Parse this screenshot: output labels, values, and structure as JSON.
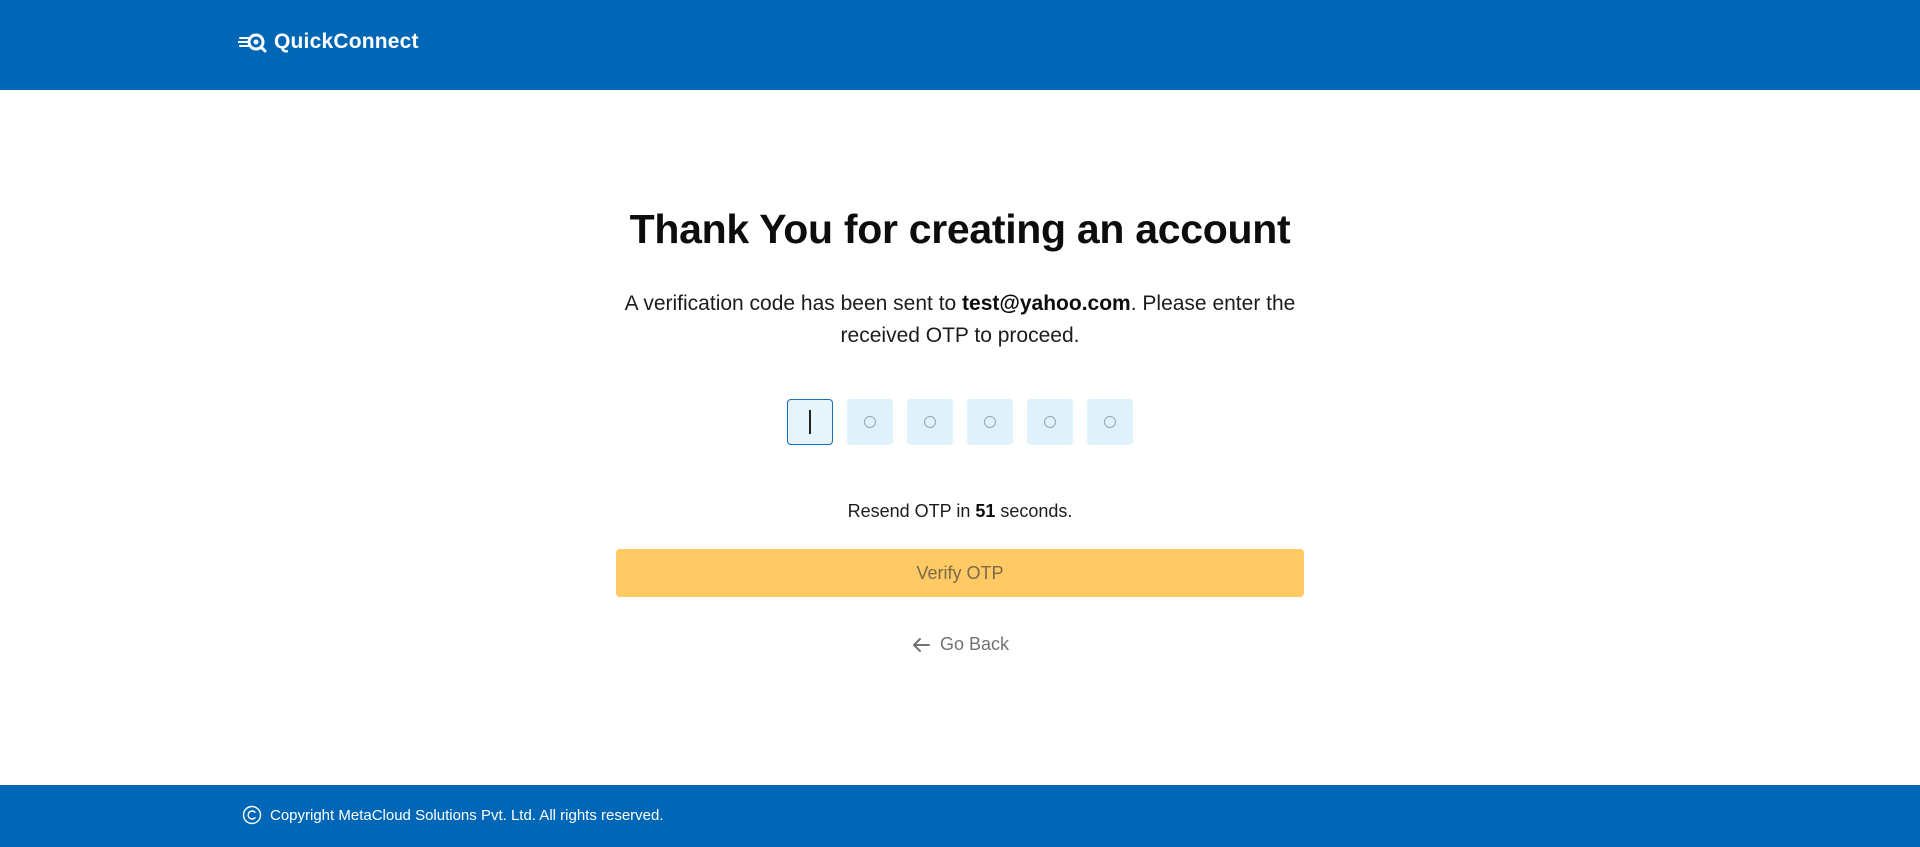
{
  "header": {
    "brand_name": "QuickConnect",
    "brand_icon": "quickconnect-logo-icon",
    "background": "#0067b6"
  },
  "main": {
    "title": "Thank You for creating an account",
    "message_prefix": "A verification code has been sent to ",
    "email": "test@yahoo.com",
    "message_suffix": ". Please enter the received OTP to proceed.",
    "otp": {
      "length": 6,
      "values": [
        "",
        "",
        "",
        "",
        "",
        ""
      ],
      "active_index": 0
    },
    "resend_prefix": "Resend OTP in ",
    "resend_seconds": "51",
    "resend_suffix": " seconds.",
    "verify_label": "Verify OTP",
    "verify_color": "#ffc964",
    "go_back_label": "Go Back",
    "go_back_icon": "arrow-left-icon"
  },
  "footer": {
    "copyright_icon": "copyright-icon",
    "copyright_text": "Copyright MetaCloud Solutions Pvt. Ltd. All rights reserved."
  }
}
